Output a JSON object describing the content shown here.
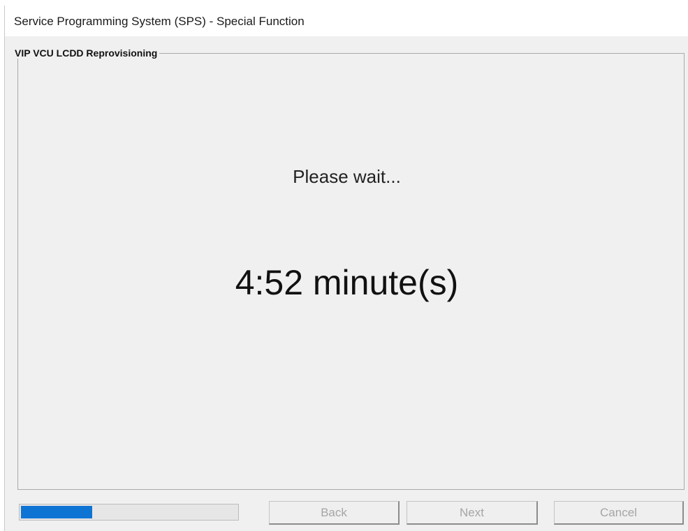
{
  "window": {
    "title": "Service Programming System (SPS) - Special Function"
  },
  "group": {
    "label": "VIP VCU LCDD Reprovisioning"
  },
  "status": {
    "message": "Please wait...",
    "remaining_time": "4:52 minute(s)"
  },
  "progress": {
    "fraction": 0.33,
    "color": "#0e74d4"
  },
  "buttons": {
    "back": "Back",
    "next": "Next",
    "cancel": "Cancel",
    "enabled": false
  }
}
